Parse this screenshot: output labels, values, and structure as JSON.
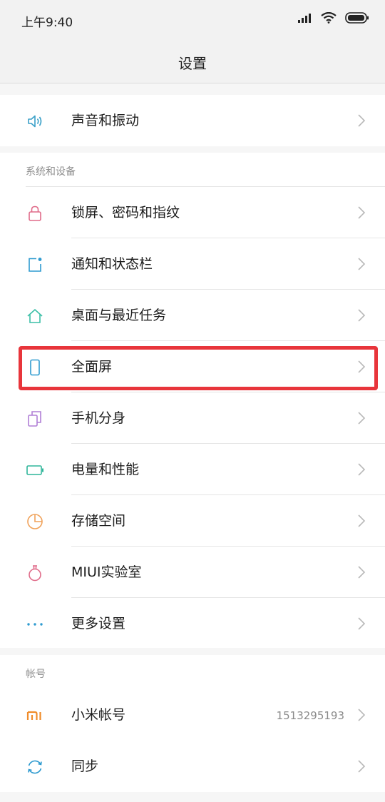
{
  "status_bar": {
    "time": "上午9:40"
  },
  "title_bar": {
    "title": "设置"
  },
  "sound_section": {
    "items": [
      {
        "label": "声音和振动",
        "icon": "speaker-icon"
      }
    ]
  },
  "system_section": {
    "header": "系统和设备",
    "items": [
      {
        "label": "锁屏、密码和指纹",
        "icon": "lock-icon"
      },
      {
        "label": "通知和状态栏",
        "icon": "notification-icon"
      },
      {
        "label": "桌面与最近任务",
        "icon": "home-icon"
      },
      {
        "label": "全面屏",
        "icon": "phone-icon"
      },
      {
        "label": "手机分身",
        "icon": "dual-app-icon"
      },
      {
        "label": "电量和性能",
        "icon": "battery-icon"
      },
      {
        "label": "存储空间",
        "icon": "storage-pie-icon"
      },
      {
        "label": "MIUI实验室",
        "icon": "flask-icon"
      },
      {
        "label": "更多设置",
        "icon": "more-dots-icon"
      }
    ]
  },
  "account_section": {
    "header": "帐号",
    "items": [
      {
        "label": "小米帐号",
        "icon": "mi-logo-icon",
        "value": "1513295193"
      },
      {
        "label": "同步",
        "icon": "sync-icon"
      }
    ]
  },
  "colors": {
    "highlight": "#e8353b"
  }
}
